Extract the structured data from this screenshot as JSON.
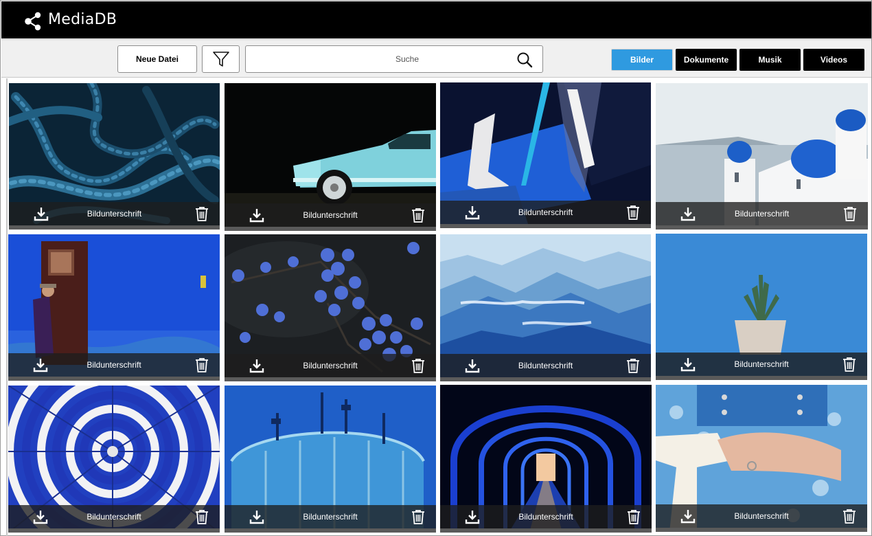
{
  "app": {
    "title": "MediaDB",
    "logo_icon": "share-icon"
  },
  "toolbar": {
    "new_file_label": "Neue Datei",
    "filter_icon": "filter-icon",
    "search": {
      "placeholder": "Suche",
      "value": ""
    },
    "tabs": [
      {
        "label": "Bilder",
        "active": true
      },
      {
        "label": "Dokumente",
        "active": false
      },
      {
        "label": "Musik",
        "active": false
      },
      {
        "label": "Videos",
        "active": false
      }
    ]
  },
  "colors": {
    "header_bg": "#000000",
    "toolbar_bg": "#f0f0f0",
    "accent": "#2f9ae0"
  },
  "gallery": {
    "items": [
      {
        "caption": "Bildunterschrift",
        "subject": "blue ropes"
      },
      {
        "caption": "Bildunterschrift",
        "subject": "turquoise vintage car"
      },
      {
        "caption": "Bildunterschrift",
        "subject": "blue abstract wall"
      },
      {
        "caption": "Bildunterschrift",
        "subject": "santorini blue domes"
      },
      {
        "caption": "Bildunterschrift",
        "subject": "man at blue wall door"
      },
      {
        "caption": "Bildunterschrift",
        "subject": "blue berries"
      },
      {
        "caption": "Bildunterschrift",
        "subject": "blue mountains"
      },
      {
        "caption": "Bildunterschrift",
        "subject": "cactus on blue background"
      },
      {
        "caption": "Bildunterschrift",
        "subject": "striped umbrella"
      },
      {
        "caption": "Bildunterschrift",
        "subject": "blue gas tank"
      },
      {
        "caption": "Bildunterschrift",
        "subject": "blue tunnel"
      },
      {
        "caption": "Bildunterschrift",
        "subject": "blue dirndl dress"
      }
    ]
  }
}
